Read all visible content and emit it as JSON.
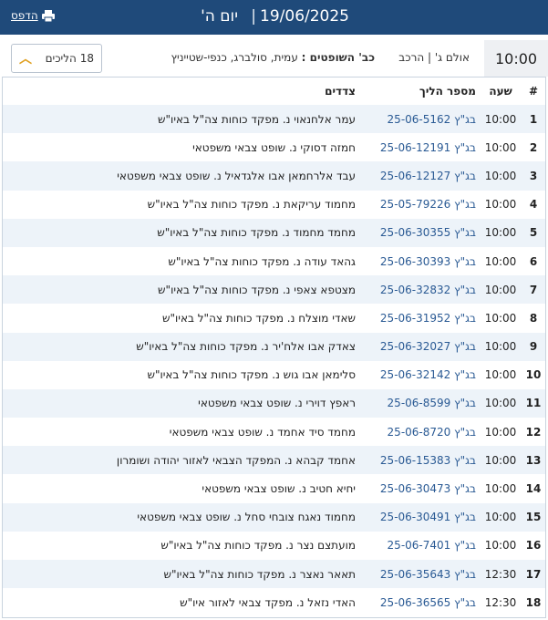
{
  "header": {
    "date": "19/06/2025",
    "day": "יום ה'",
    "print_label": "הדפס",
    "print_icon": "printer-icon",
    "bg_color": "#1f4a7a"
  },
  "session": {
    "time": "10:00",
    "hall": "אולם ג' | הרכב",
    "judges_label": "כב' השופטים :",
    "judges": "עמית, סולברג, כנפי-שטייניץ",
    "cases_count": "18 הליכים",
    "collapse_icon": "chevron-up-icon"
  },
  "table": {
    "headers": {
      "num": "#",
      "time": "שעה",
      "case": "מספר הליך",
      "parties": "צדדים"
    },
    "rows": [
      {
        "num": "1",
        "time": "10:00",
        "case": "בג\"ץ 25-06-5162",
        "parties": "עמר אלחנאוי נ. מפקד כוחות צה\"ל באיו\"ש"
      },
      {
        "num": "2",
        "time": "10:00",
        "case": "בג\"ץ 25-06-12191",
        "parties": "חמזה דסוקי נ. שופט צבאי משפטאי"
      },
      {
        "num": "3",
        "time": "10:00",
        "case": "בג\"ץ 25-06-12127",
        "parties": "עבד אלרחמאן אבו אלגדאיל נ. שופט צבאי משפטאי"
      },
      {
        "num": "4",
        "time": "10:00",
        "case": "בג\"ץ 25-05-79226",
        "parties": "מחמוד עריקאת נ. מפקד כוחות צה\"ל באיו\"ש"
      },
      {
        "num": "5",
        "time": "10:00",
        "case": "בג\"ץ 25-06-30355",
        "parties": "מחמד מחמוד נ. מפקד כוחות צה\"ל באיו\"ש"
      },
      {
        "num": "6",
        "time": "10:00",
        "case": "בג\"ץ 25-06-30393",
        "parties": "גהאד עודה נ. מפקד כוחות צה\"ל באיו\"ש"
      },
      {
        "num": "7",
        "time": "10:00",
        "case": "בג\"ץ 25-06-32832",
        "parties": "מצטפא צאפי נ. מפקד כוחות צה\"ל באיו\"ש"
      },
      {
        "num": "8",
        "time": "10:00",
        "case": "בג\"ץ 25-06-31952",
        "parties": "שאדי מוצלח נ. מפקד כוחות צה\"ל באיו\"ש"
      },
      {
        "num": "9",
        "time": "10:00",
        "case": "בג\"ץ 25-06-32027",
        "parties": "צאדק אבו אלח'יר נ. מפקד כוחות צה\"ל באיו\"ש"
      },
      {
        "num": "10",
        "time": "10:00",
        "case": "בג\"ץ 25-06-32142",
        "parties": "סלימאן אבו גוש נ. מפקד כוחות צה\"ל באיו\"ש"
      },
      {
        "num": "11",
        "time": "10:00",
        "case": "בג\"ץ 25-06-8599",
        "parties": "ראפץ דוירי נ. שופט צבאי משפטאי"
      },
      {
        "num": "12",
        "time": "10:00",
        "case": "בג\"ץ 25-06-8720",
        "parties": "מחמד סיד אחמד נ. שופט צבאי משפטאי"
      },
      {
        "num": "13",
        "time": "10:00",
        "case": "בג\"ץ 25-06-15383",
        "parties": "אחמד קבהא נ. המפקד הצבאי לאזור יהודה ושומרון"
      },
      {
        "num": "14",
        "time": "10:00",
        "case": "בג\"ץ 25-06-30473",
        "parties": "יחיא חטיב נ. שופט צבאי משפטאי"
      },
      {
        "num": "15",
        "time": "10:00",
        "case": "בג\"ץ 25-06-30491",
        "parties": "מחמוד נאגח צובחי סחל נ. שופט צבאי משפטאי"
      },
      {
        "num": "16",
        "time": "10:00",
        "case": "בג\"ץ 25-06-7401",
        "parties": "מועתצם נצר נ. מפקד כוחות צה\"ל באיו\"ש"
      },
      {
        "num": "17",
        "time": "12:30",
        "case": "בג\"ץ 25-06-35643",
        "parties": "תאאר נאצר נ. מפקד כוחות צה\"ל באיו\"ש"
      },
      {
        "num": "18",
        "time": "12:30",
        "case": "בג\"ץ 25-06-36565",
        "parties": "האדי נזאל נ. מפקד צבאי לאזור איו\"ש"
      }
    ]
  },
  "colors": {
    "row_stripe": "#edf3f9",
    "link": "#2a5a94",
    "chevron": "#e0a020"
  }
}
